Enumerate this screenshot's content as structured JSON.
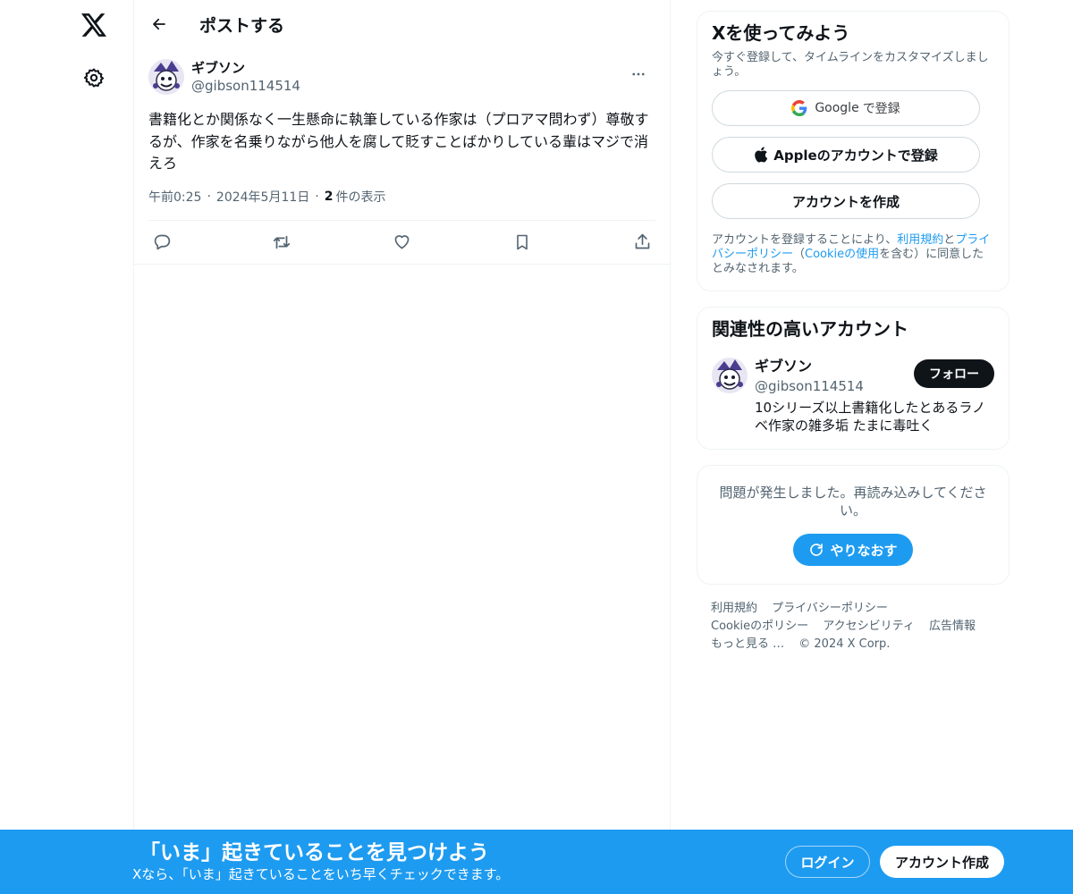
{
  "header": {
    "title": "ポストする"
  },
  "post": {
    "author_name": "ギブソン",
    "author_handle": "@gibson114514",
    "text": "書籍化とか関係なく一生懸命に執筆している作家は（プロアマ問わず）尊敬するが、作家を名乗りながら他人を腐して貶すことばかりしている輩はマジで消えろ",
    "time": "午前0:25",
    "date": "2024年5月11日",
    "view_count": "2",
    "view_label": "件の表示"
  },
  "signup_card": {
    "title": "Xを使ってみよう",
    "subtitle": "今すぐ登録して、タイムラインをカスタマイズしましょう。",
    "google_label": "Google",
    "google_suffix": "で登録",
    "apple_label": "Appleのアカウントで登録",
    "create_label": "アカウントを作成",
    "terms_1": "アカウントを登録することにより、",
    "terms_link_tos": "利用規約",
    "terms_2": "と",
    "terms_link_privacy": "プライバシーポリシー",
    "terms_3": "（",
    "terms_link_cookie": "Cookieの使用",
    "terms_4": "を含む）に同意したとみなされます。"
  },
  "recommend_card": {
    "title": "関連性の高いアカウント",
    "name": "ギブソン",
    "handle": "@gibson114514",
    "bio": "10シリーズ以上書籍化したとあるラノベ作家の雑多垢 たまに毒吐く",
    "follow_label": "フォロー"
  },
  "error_card": {
    "message": "問題が発生しました。再読み込みしてください。",
    "retry_label": "やりなおす"
  },
  "footer": {
    "links": [
      "利用規約",
      "プライバシーポリシー",
      "Cookieのポリシー",
      "アクセシビリティ",
      "広告情報",
      "もっと見る …"
    ],
    "copyright": "© 2024 X Corp."
  },
  "bottom_bar": {
    "title": "「いま」起きていることを見つけよう",
    "subtitle": "Xなら、「いま」起きていることをいち早くチェックできます。",
    "login_label": "ログイン",
    "signup_label": "アカウント作成"
  },
  "colors": {
    "accent": "#1d9bf0",
    "text_primary": "#0f1419",
    "text_secondary": "#536471",
    "border": "#eff3f4"
  },
  "icons": {
    "logo": "x-logo-icon",
    "settings": "gear-icon",
    "back": "arrow-left-icon",
    "more": "more-dots-icon",
    "reply": "reply-icon",
    "repost": "repost-icon",
    "like": "heart-icon",
    "bookmark": "bookmark-icon",
    "share": "share-icon",
    "retry": "refresh-icon"
  }
}
